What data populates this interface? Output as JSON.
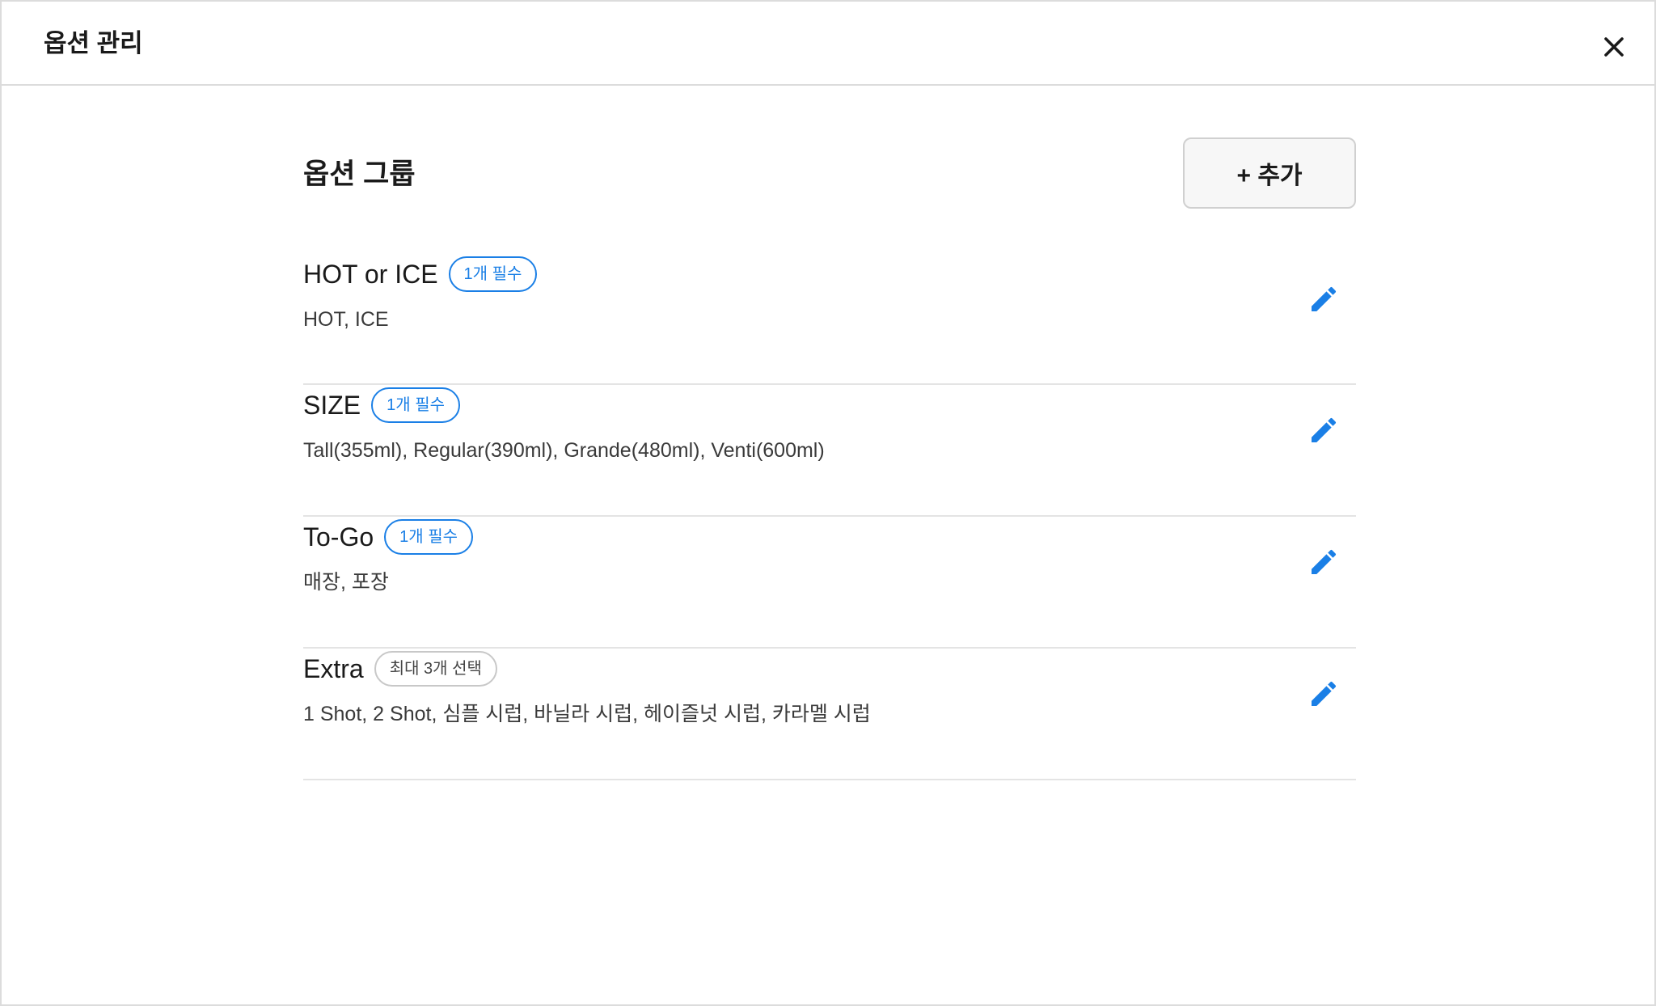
{
  "window": {
    "title": "옵션 관리"
  },
  "section": {
    "title": "옵션 그룹",
    "add_label": "+ 추가"
  },
  "groups": [
    {
      "name": "HOT or ICE",
      "badge": "1개 필수",
      "badge_style": "required",
      "values": "HOT, ICE"
    },
    {
      "name": "SIZE",
      "badge": "1개 필수",
      "badge_style": "required",
      "values": "Tall(355ml), Regular(390ml), Grande(480ml), Venti(600ml)"
    },
    {
      "name": "To-Go",
      "badge": "1개 필수",
      "badge_style": "required",
      "values": "매장, 포장"
    },
    {
      "name": "Extra",
      "badge": "최대 3개 선택",
      "badge_style": "optional",
      "values": "1 Shot, 2 Shot, 심플 시럽, 바닐라 시럽, 헤이즐넛 시럽, 카라멜 시럽"
    }
  ],
  "icons": {
    "close": "close-icon",
    "edit": "pencil-icon"
  },
  "colors": {
    "accent": "#1a7fe6",
    "border": "#dcdcdc",
    "badge_optional_border": "#c8c8c8"
  }
}
